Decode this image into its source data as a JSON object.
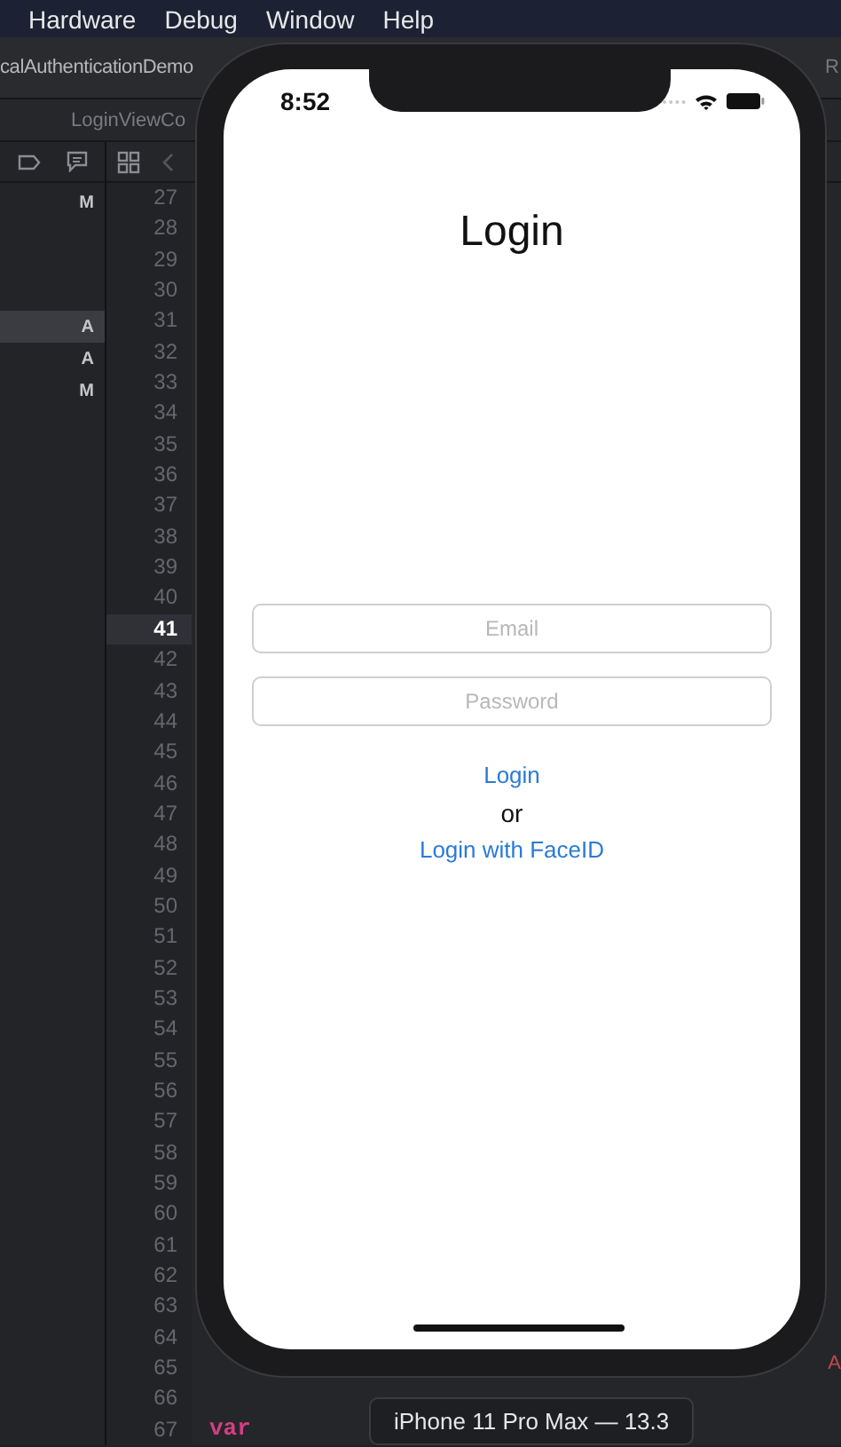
{
  "menu_bar": [
    "Hardware",
    "Debug",
    "Window",
    "Help"
  ],
  "breadcrumb": {
    "project": "calAuthenticationDemo",
    "right": "R"
  },
  "file_tab": "LoginViewCo",
  "navigator": [
    {
      "badge": "M",
      "selected": false
    },
    {
      "badge": "A",
      "selected": true
    },
    {
      "badge": "A",
      "selected": false
    },
    {
      "badge": "M",
      "selected": false
    }
  ],
  "line_numbers": [
    {
      "n": "27",
      "current": false
    },
    {
      "n": "28",
      "current": false
    },
    {
      "n": "29",
      "current": false
    },
    {
      "n": "30",
      "current": false
    },
    {
      "n": "31",
      "current": false
    },
    {
      "n": "32",
      "current": false
    },
    {
      "n": "33",
      "current": false
    },
    {
      "n": "34",
      "current": false
    },
    {
      "n": "35",
      "current": false
    },
    {
      "n": "36",
      "current": false
    },
    {
      "n": "37",
      "current": false
    },
    {
      "n": "38",
      "current": false
    },
    {
      "n": "39",
      "current": false
    },
    {
      "n": "40",
      "current": false
    },
    {
      "n": "41",
      "current": true
    },
    {
      "n": "42",
      "current": false
    },
    {
      "n": "43",
      "current": false
    },
    {
      "n": "44",
      "current": false
    },
    {
      "n": "45",
      "current": false
    },
    {
      "n": "46",
      "current": false
    },
    {
      "n": "47",
      "current": false
    },
    {
      "n": "48",
      "current": false
    },
    {
      "n": "49",
      "current": false
    },
    {
      "n": "50",
      "current": false
    },
    {
      "n": "51",
      "current": false
    },
    {
      "n": "52",
      "current": false
    },
    {
      "n": "53",
      "current": false
    },
    {
      "n": "54",
      "current": false
    },
    {
      "n": "55",
      "current": false
    },
    {
      "n": "56",
      "current": false
    },
    {
      "n": "57",
      "current": false
    },
    {
      "n": "58",
      "current": false
    },
    {
      "n": "59",
      "current": false
    },
    {
      "n": "60",
      "current": false
    },
    {
      "n": "61",
      "current": false
    },
    {
      "n": "62",
      "current": false
    },
    {
      "n": "63",
      "current": false
    },
    {
      "n": "64",
      "current": false
    },
    {
      "n": "65",
      "current": false
    },
    {
      "n": "66",
      "current": false
    },
    {
      "n": "67",
      "current": false
    }
  ],
  "code": {
    "keyword": "var",
    "fragment": "A"
  },
  "simulator": {
    "time": "8:52",
    "title": "Login",
    "email_placeholder": "Email",
    "password_placeholder": "Password",
    "login_link": "Login",
    "or": "or",
    "faceid_link": "Login with FaceID",
    "device_label": "iPhone 11 Pro Max — 13.3"
  }
}
